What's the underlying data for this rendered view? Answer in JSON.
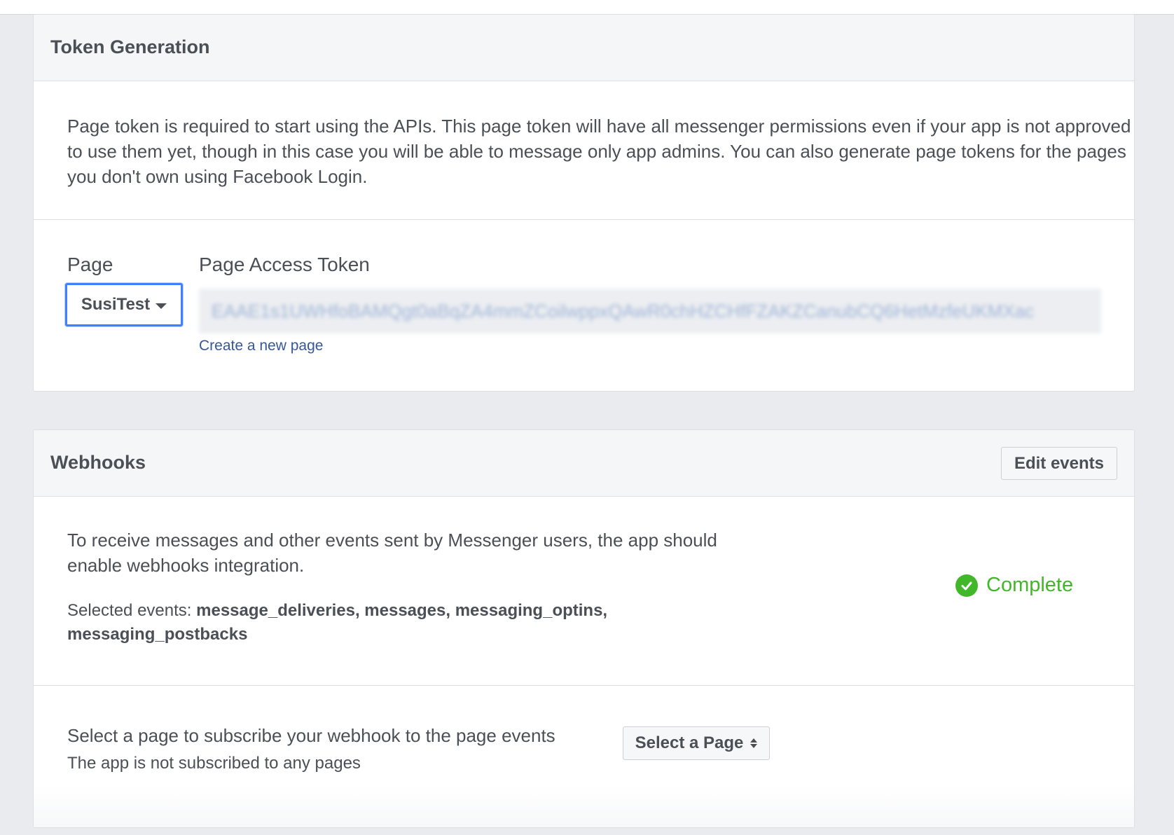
{
  "token_generation": {
    "title": "Token Generation",
    "description": "Page token is required to start using the APIs. This page token will have all messenger permissions even if your app is not approved to use them yet, though in this case you will be able to message only app admins. You can also generate page tokens for the pages you don't own using Facebook Login.",
    "page_label": "Page",
    "page_selected": "SusiTest",
    "token_label": "Page Access Token",
    "token_value": "EAAE1s1UWHfoBAMQgt0aBqZA4mmZCoilwppxQAwR0chHZCHfFZAKZCanubCQ6HetMzfeUKMXac",
    "create_page_link": "Create a new page"
  },
  "webhooks": {
    "title": "Webhooks",
    "edit_button": "Edit events",
    "description": "To receive messages and other events sent by Messenger users, the app should enable webhooks integration.",
    "selected_events_label": "Selected events: ",
    "selected_events_value": "message_deliveries, messages, messaging_optins, messaging_postbacks",
    "status": "Complete",
    "status_color": "#42b72a",
    "subscribe_text": "Select a page to subscribe your webhook to the page events",
    "subscribe_status": "The app is not subscribed to any pages",
    "select_page_label": "Select a Page"
  },
  "colors": {
    "link": "#365899",
    "focus_border": "#4080ff",
    "background": "#e9ebee"
  }
}
